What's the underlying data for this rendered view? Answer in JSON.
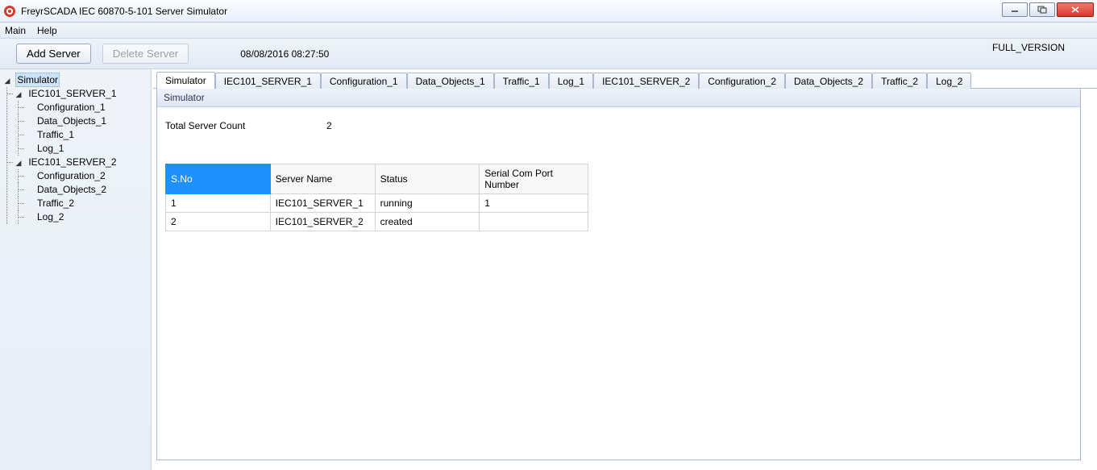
{
  "window": {
    "title": "FreyrSCADA IEC 60870-5-101 Server Simulator"
  },
  "menu": {
    "main": "Main",
    "help": "Help"
  },
  "toolbar": {
    "add_server": "Add Server",
    "delete_server": "Delete Server",
    "timestamp": "08/08/2016 08:27:50",
    "version": "FULL_VERSION"
  },
  "tree": {
    "root": "Simulator",
    "servers": [
      {
        "name": "IEC101_SERVER_1",
        "children": [
          "Configuration_1",
          "Data_Objects_1",
          "Traffic_1",
          "Log_1"
        ]
      },
      {
        "name": "IEC101_SERVER_2",
        "children": [
          "Configuration_2",
          "Data_Objects_2",
          "Traffic_2",
          "Log_2"
        ]
      }
    ]
  },
  "tabs": [
    "Simulator",
    "IEC101_SERVER_1",
    "Configuration_1",
    "Data_Objects_1",
    "Traffic_1",
    "Log_1",
    "IEC101_SERVER_2",
    "Configuration_2",
    "Data_Objects_2",
    "Traffic_2",
    "Log_2"
  ],
  "panel": {
    "header": "Simulator",
    "total_label": "Total Server Count",
    "total_value": "2",
    "columns": [
      "S.No",
      "Server Name",
      "Status",
      "Serial Com Port Number"
    ],
    "rows": [
      {
        "sno": "1",
        "name": "IEC101_SERVER_1",
        "status": "running",
        "port": "1"
      },
      {
        "sno": "2",
        "name": "IEC101_SERVER_2",
        "status": "created",
        "port": ""
      }
    ]
  }
}
